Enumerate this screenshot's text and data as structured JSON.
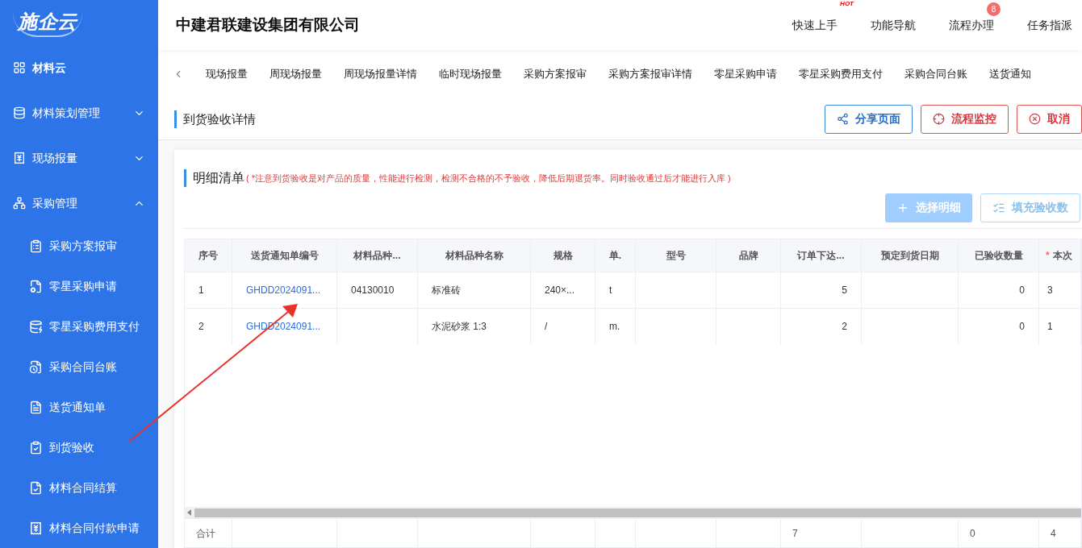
{
  "sidebar": {
    "logo": "施企云",
    "items": [
      {
        "label": "材料云",
        "kind": "heading"
      },
      {
        "label": "材料策划管理",
        "kind": "group",
        "expanded": false
      },
      {
        "label": "现场报量",
        "kind": "group",
        "expanded": false
      },
      {
        "label": "采购管理",
        "kind": "group",
        "expanded": true,
        "children": [
          {
            "label": "采购方案报审"
          },
          {
            "label": "零星采购申请"
          },
          {
            "label": "零星采购费用支付"
          },
          {
            "label": "采购合同台账"
          },
          {
            "label": "送货通知单"
          },
          {
            "label": "到货验收"
          },
          {
            "label": "材料合同结算"
          },
          {
            "label": "材料合同付款申请"
          }
        ]
      }
    ]
  },
  "header": {
    "company": "中建君联建设集团有限公司",
    "nav": [
      {
        "label": "快速上手",
        "tag": "HOT"
      },
      {
        "label": "功能导航"
      },
      {
        "label": "流程办理",
        "badge": "8"
      },
      {
        "label": "任务指派"
      }
    ]
  },
  "tabs": [
    "现场报量",
    "周现场报量",
    "周现场报量详情",
    "临时现场报量",
    "采购方案报审",
    "采购方案报审详情",
    "零星采购申请",
    "零星采购费用支付",
    "采购合同台账",
    "送货通知"
  ],
  "page": {
    "title": "到货验收详情",
    "actions": [
      {
        "label": "分享页面",
        "kind": "share"
      },
      {
        "label": "流程监控",
        "kind": "monitor"
      },
      {
        "label": "取消",
        "kind": "cancel"
      }
    ]
  },
  "detail": {
    "title": "明细清单",
    "note": "( *注意到货验收是对产品的质量，性能进行检测，检测不合格的不予验收，降低后期退货率。同时验收通过后才能进行入库 )",
    "buttons": [
      {
        "label": "选择明细",
        "kind": "add",
        "disabled": true
      },
      {
        "label": "填充验收数",
        "kind": "fill",
        "disabled": true
      }
    ],
    "table": {
      "columns": [
        {
          "label": "序号"
        },
        {
          "label": "送货通知单编号"
        },
        {
          "label": "材料品种..."
        },
        {
          "label": "材料品种名称"
        },
        {
          "label": "规格"
        },
        {
          "label": "单."
        },
        {
          "label": "型号"
        },
        {
          "label": "品牌"
        },
        {
          "label": "订单下达..."
        },
        {
          "label": "预定到货日期"
        },
        {
          "label": "已验收数量"
        },
        {
          "label": "本次",
          "mark": "*"
        }
      ],
      "rows": [
        {
          "seq": "1",
          "notice_no": "GHDD2024091...",
          "material_code": "04130010",
          "material_name": "标准砖",
          "spec": "240×...",
          "unit": "t",
          "order_qty": "5",
          "received_qty": "0",
          "this_qty": "3"
        },
        {
          "seq": "2",
          "notice_no": "GHDD2024091...",
          "material_name": "水泥砂浆 1:3",
          "spec": "/",
          "unit": "m.",
          "order_qty": "2",
          "received_qty": "0",
          "this_qty": "1"
        }
      ],
      "footer": {
        "label": "合计",
        "order_qty": "7",
        "received_qty": "0",
        "this_qty": "4"
      }
    }
  }
}
